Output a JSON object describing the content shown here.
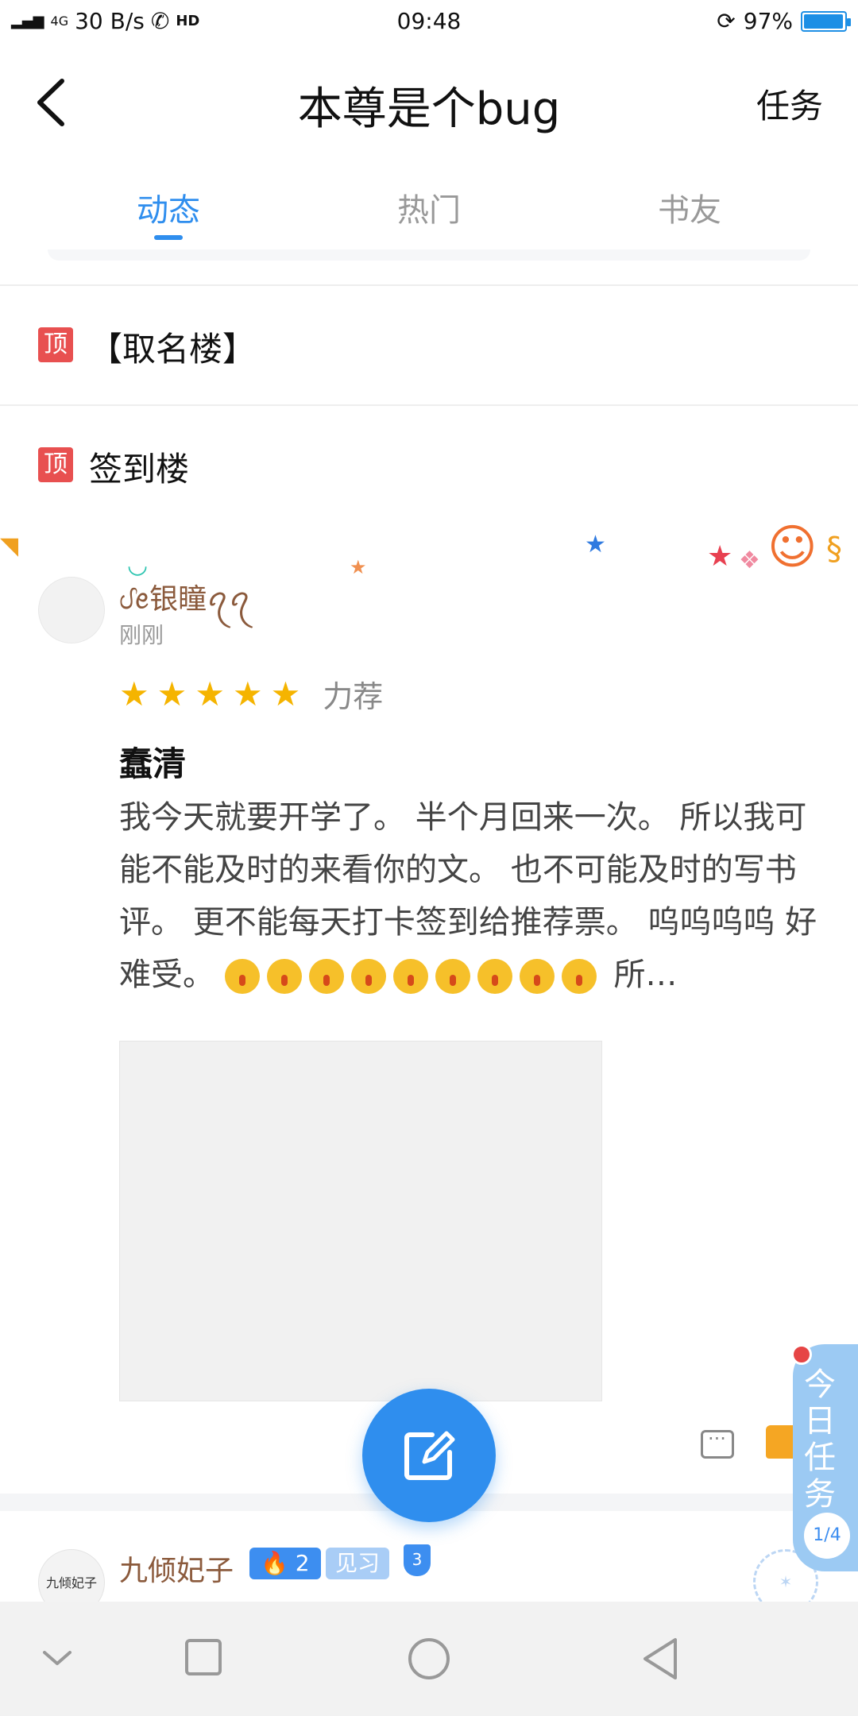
{
  "status_bar": {
    "network": "4G",
    "speed": "30 B/s",
    "hd": "HD",
    "time": "09:48",
    "battery": "97%",
    "battery_level": 0.97
  },
  "header": {
    "title": "本尊是个bug",
    "task_label": "任务"
  },
  "tabs": [
    {
      "label": "动态",
      "active": true
    },
    {
      "label": "热门",
      "active": false
    },
    {
      "label": "书友",
      "active": false
    }
  ],
  "pinned": [
    {
      "badge": "顶",
      "text": "【取名楼】"
    },
    {
      "badge": "顶",
      "text": "签到楼"
    }
  ],
  "post": {
    "username": "ᦔꫀ银瞳ꪖꪖ",
    "time": "刚刚",
    "rating": 5,
    "rating_label": "力荐",
    "title": "蠢清",
    "body_text": "我今天就要开学了。 半个月回来一次。 所以我可能不能及时的来看你的文。 也不可能及时的写书评。 更不能每天打卡签到给推荐票。 呜呜呜呜 好难受。",
    "emoji_count": 9,
    "body_tail": "所…",
    "actions": {
      "comment_icon": "comment-icon",
      "like_icon": "thumbs-up-icon"
    }
  },
  "fab": {
    "icon": "edit-icon"
  },
  "post2": {
    "username": "九倾妃子",
    "avatar_text": "九倾妃子",
    "fire_level": "2",
    "level_label": "见习",
    "shield_level": "3"
  },
  "today_task": {
    "label": "今日任务",
    "progress": "1/4"
  },
  "colors": {
    "accent": "#2f8eee",
    "pin_red": "#e85050",
    "star": "#f5b400",
    "username": "#8b5a3c"
  }
}
